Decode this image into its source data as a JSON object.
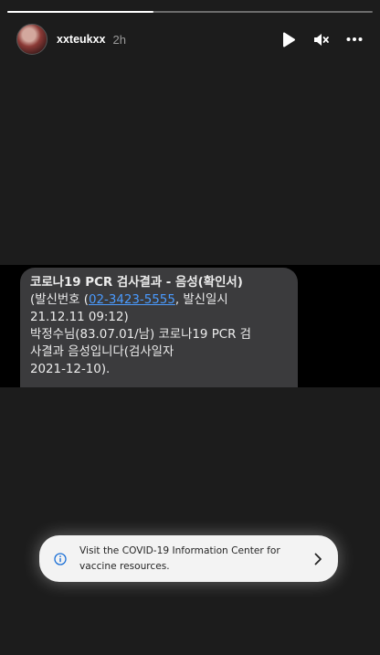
{
  "story": {
    "progress": 0.4,
    "username": "xxteukxx",
    "posted_ago": "2h"
  },
  "controls": {
    "play_icon": "play-icon",
    "mute_icon": "mute-icon",
    "more_icon": "more-options-icon"
  },
  "message": {
    "title": "코로나19 PCR 검사결과 - 음성(확인서)",
    "sender_prefix": "(발신번호 (",
    "phone": "02-3423-5555",
    "sender_suffix": ", 발신일시",
    "datetime": "21.12.11 09:12)",
    "body_line1": "박정수님(83.07.01/남) 코로나19 PCR 검",
    "body_line2": "사결과 음성입니다(검사일자",
    "body_line3": "2021-12-10)."
  },
  "toast": {
    "line1": "Visit the COVID-19 Information Center for",
    "line2": "vaccine resources.",
    "info_icon": "info-icon",
    "chevron_icon": "chevron-right-icon"
  },
  "colors": {
    "link": "#4a9bff",
    "bubble": "#3b3b3d",
    "toast_bg": "#f3f3f3",
    "info_icon": "#1a6fd6"
  }
}
